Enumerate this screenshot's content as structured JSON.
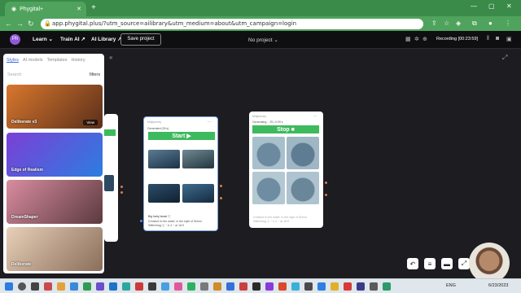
{
  "browser": {
    "tab_title": "Phygital+",
    "tab_close": "✕",
    "new_tab": "+",
    "url": "app.phygital.plus/?utm_source=ailibrary&utm_medium=about&utm_campaign=login"
  },
  "header": {
    "logo_text": "Ph",
    "menu": [
      {
        "label": "Learn ⌄"
      },
      {
        "label": "Train AI ↗"
      },
      {
        "label": "AI Library ↗"
      }
    ],
    "save_button": "Save project",
    "project_select": "No project ⌄",
    "recording": "Recording [00:23:59]"
  },
  "panel": {
    "tabs": [
      "Styles",
      "AI models",
      "Templates",
      "History"
    ],
    "search_placeholder": "Search",
    "filters": "filters",
    "models": [
      {
        "label": "Deliberate v3",
        "view": "View",
        "colors": [
          "#d9772d",
          "#5a2f1b"
        ]
      },
      {
        "label": "Edge of Realism",
        "colors": [
          "#7b3fd6",
          "#2d7de0"
        ]
      },
      {
        "label": "DreamShaper",
        "colors": [
          "#d98ca0",
          "#5b3a3f"
        ]
      },
      {
        "label": "Reliberate",
        "colors": [
          "#e8d0b8",
          "#8a6e5b"
        ]
      }
    ]
  },
  "cards": {
    "middle": {
      "meta": "Midjourney",
      "status": "Generated (39 s)",
      "button": "Start ▶",
      "caption_title": "Big hairy beast ⓘ",
      "caption": "Creature in the water, in the style of Simon Stålenhag ⓒ − b 4 − ar 16:9"
    },
    "right": {
      "meta": "Midjourney",
      "status": "Generating... 25 | 0:09 s",
      "button": "Stop ■",
      "caption": "Creature in the water, in the style of Simon Stålenhag ⓒ − b 4 − ar 16:9"
    }
  },
  "taskbar": {
    "lang": "ENG",
    "date": "6/23/2023"
  }
}
